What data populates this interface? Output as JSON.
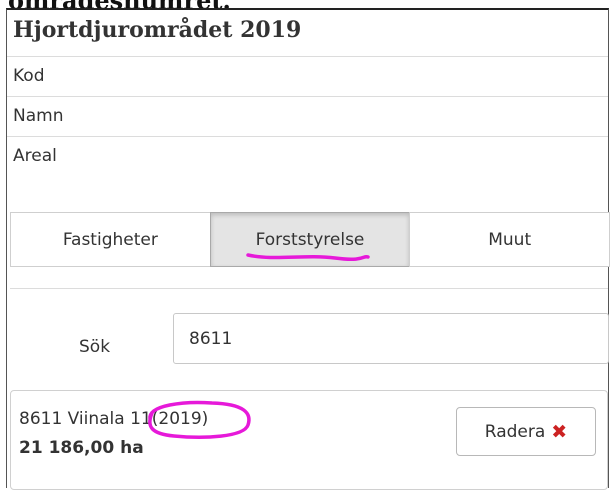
{
  "header": {
    "cut_text": "områdesnumret."
  },
  "panel": {
    "title": "Hjortdjurområdet 2019",
    "fields": [
      {
        "label": "Kod"
      },
      {
        "label": "Namn"
      },
      {
        "label": "Areal"
      }
    ]
  },
  "tabs": [
    {
      "label": "Fastigheter",
      "active": false
    },
    {
      "label": "Forststyrelse",
      "active": true
    },
    {
      "label": "Muut",
      "active": false
    }
  ],
  "search": {
    "label": "Sök",
    "value": "8611"
  },
  "result": {
    "name_prefix": "8611 Viinala 11",
    "year": "(2019)",
    "area": "21 186,00 ha",
    "delete_label": "Radera",
    "delete_icon": "close-icon"
  },
  "colors": {
    "annotation": "#e619d9",
    "delete_icon": "#cc2222"
  }
}
